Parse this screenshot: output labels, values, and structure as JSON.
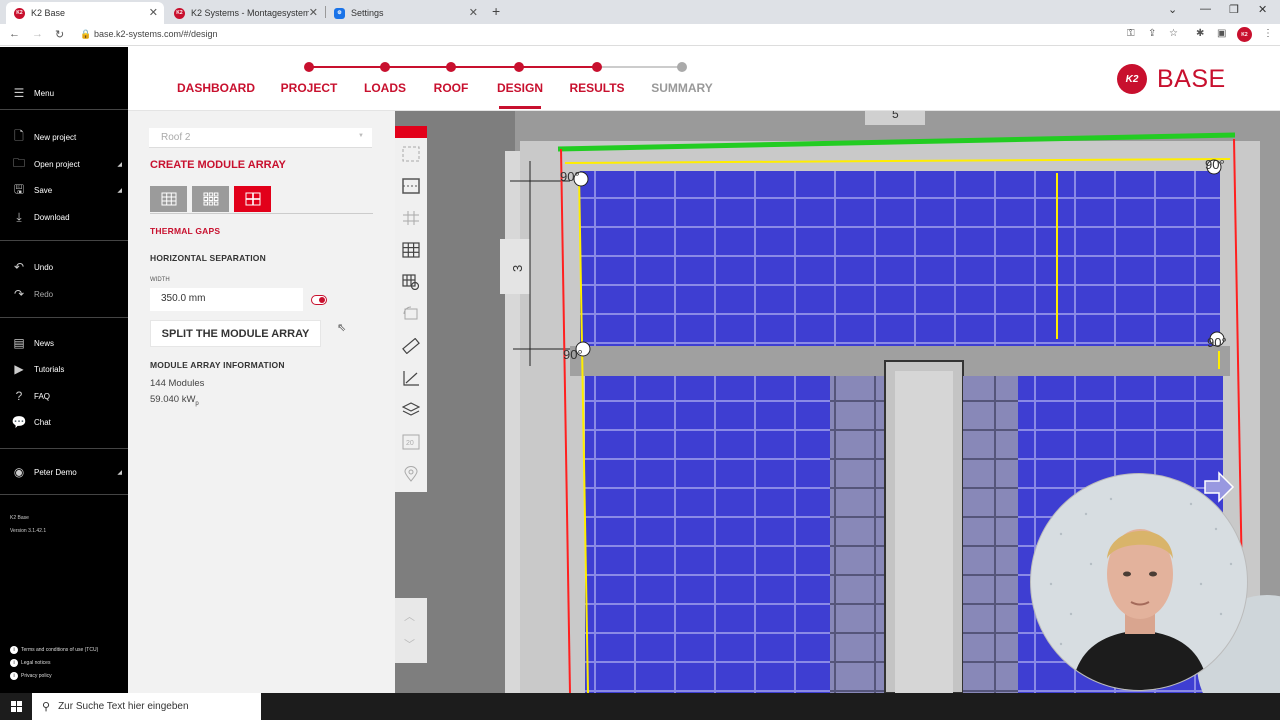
{
  "browser": {
    "tabs": [
      {
        "title": "K2 Base",
        "fav": "K2",
        "active": true
      },
      {
        "title": "K2 Systems - Montagesysteme fü",
        "fav": "K2",
        "active": false
      },
      {
        "title": "Settings",
        "fav": "gear-icon",
        "active": false
      }
    ],
    "url": "base.k2-systems.com/#/design",
    "profile": "K2"
  },
  "sidebar": {
    "menu": "Menu",
    "items": [
      {
        "label": "New project",
        "icon": "new-project-icon"
      },
      {
        "label": "Open project",
        "icon": "folder-icon"
      },
      {
        "label": "Save",
        "icon": "save-icon"
      },
      {
        "label": "Download",
        "icon": "download-icon"
      }
    ],
    "undo": "Undo",
    "redo": "Redo",
    "help": [
      {
        "label": "News",
        "icon": "news-icon"
      },
      {
        "label": "Tutorials",
        "icon": "tutorials-icon"
      },
      {
        "label": "FAQ",
        "icon": "faq-icon"
      },
      {
        "label": "Chat",
        "icon": "chat-icon"
      }
    ],
    "user": "Peter Demo",
    "app_name": "K2 Base",
    "version": "Version 3.1.42.1",
    "footer": [
      "Terms and conditions of use (TCU)",
      "Legal notices",
      "Privacy policy"
    ]
  },
  "steps": [
    {
      "label": "DASHBOARD",
      "state": "done"
    },
    {
      "label": "PROJECT",
      "state": "done"
    },
    {
      "label": "LOADS",
      "state": "done"
    },
    {
      "label": "ROOF",
      "state": "done"
    },
    {
      "label": "DESIGN",
      "state": "current"
    },
    {
      "label": "RESULTS",
      "state": "done"
    },
    {
      "label": "SUMMARY",
      "state": "todo"
    }
  ],
  "logo": {
    "badge": "K2",
    "word": "BASE"
  },
  "panel": {
    "roof_select": "Roof 2",
    "title": "CREATE MODULE ARRAY",
    "thermal_gaps": "THERMAL GAPS",
    "horizontal_separation": "HORIZONTAL SEPARATION",
    "width_label": "WIDTH",
    "width_value": "350.0 mm",
    "split_button": "SPLIT THE MODULE ARRAY",
    "info_title": "MODULE ARRAY INFORMATION",
    "modules": "144 Modules",
    "power": "59.040 kW",
    "power_sub": "p"
  },
  "map": {
    "dimension_label": "3",
    "angles": [
      "90°",
      "90°",
      "90°",
      "90°"
    ],
    "colors": {
      "module": "#3a3ad6",
      "edge_green": "#22cc22",
      "edge_yellow": "#ffee00",
      "edge_red": "#ff2020"
    }
  },
  "taskbar": {
    "search_placeholder": "Zur Suche Text hier eingeben"
  }
}
